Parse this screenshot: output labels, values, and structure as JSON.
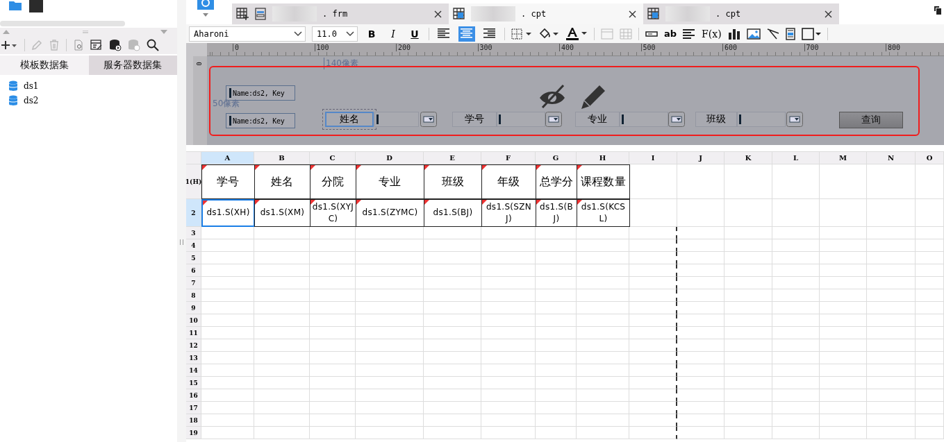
{
  "left_panel": {
    "tabs": [
      {
        "label": "模板数据集",
        "selected": true
      },
      {
        "label": "服务器数据集",
        "selected": false
      }
    ],
    "datasets": [
      {
        "name": "ds1"
      },
      {
        "name": "ds2"
      }
    ]
  },
  "file_tabs": [
    {
      "label": ". frm",
      "selected": false
    },
    {
      "label": ". cpt",
      "selected": true
    },
    {
      "label": ". cpt",
      "selected": false
    }
  ],
  "format_bar": {
    "font": "Aharoni",
    "size": "11.0",
    "style_buttons": [
      "B",
      "I",
      "U"
    ],
    "align": [
      {
        "selected": false
      },
      {
        "selected": true
      },
      {
        "selected": false
      }
    ],
    "text_tool": "ab",
    "formula_tool": "F(x)"
  },
  "ruler": {
    "ticks": [
      "0",
      "100",
      "200",
      "300",
      "400",
      "500",
      "600",
      "700",
      "800"
    ],
    "vertical_tick": "0"
  },
  "form": {
    "width_note": "140像素",
    "height_note": "50像素",
    "widgets": [
      {
        "kind": "name",
        "text": "Name:ds2, Key"
      },
      {
        "kind": "name",
        "text": "Name:ds2, Key"
      },
      {
        "kind": "label",
        "text": "姓名",
        "selected": true
      },
      {
        "kind": "combo"
      },
      {
        "kind": "label",
        "text": "学号",
        "selected": false
      },
      {
        "kind": "combo"
      },
      {
        "kind": "label",
        "text": "专业",
        "selected": false
      },
      {
        "kind": "combo"
      },
      {
        "kind": "label",
        "text": "班级",
        "selected": false
      },
      {
        "kind": "combo"
      },
      {
        "kind": "button",
        "text": "查询"
      }
    ]
  },
  "sheet": {
    "columns": [
      {
        "label": "A",
        "selected": true
      },
      {
        "label": "B",
        "selected": false
      },
      {
        "label": "C",
        "selected": false
      },
      {
        "label": "D",
        "selected": false
      },
      {
        "label": "E",
        "selected": false
      },
      {
        "label": "F",
        "selected": false
      },
      {
        "label": "G",
        "selected": false
      },
      {
        "label": "H",
        "selected": false
      },
      {
        "label": "I",
        "selected": false
      },
      {
        "label": "J",
        "selected": false
      },
      {
        "label": "K",
        "selected": false
      },
      {
        "label": "L",
        "selected": false
      },
      {
        "label": "M",
        "selected": false
      },
      {
        "label": "N",
        "selected": false
      },
      {
        "label": "O",
        "selected": false
      }
    ],
    "rows": [
      {
        "label": "1(H)",
        "selected": false,
        "cells": [
          {
            "text": "学号",
            "selected": false
          },
          {
            "text": "姓名",
            "selected": false
          },
          {
            "text": "分院",
            "selected": false
          },
          {
            "text": "专业",
            "selected": false
          },
          {
            "text": "班级",
            "selected": false
          },
          {
            "text": "年级",
            "selected": false
          },
          {
            "text": "总学分",
            "selected": false
          },
          {
            "text": "课程数量",
            "selected": false
          }
        ]
      },
      {
        "label": "2",
        "selected": true,
        "cells": [
          {
            "text": "ds1.S(XH)",
            "selected": true
          },
          {
            "text": "ds1.S(XM)",
            "selected": false
          },
          {
            "text": "ds1.S(XYJC)",
            "selected": false
          },
          {
            "text": "ds1.S(ZYMC)",
            "selected": false
          },
          {
            "text": "ds1.S(BJ)",
            "selected": false
          },
          {
            "text": "ds1.S(SZNJ)",
            "selected": false
          },
          {
            "text": "ds1.S(BJ)",
            "selected": false
          },
          {
            "text": "ds1.S(KCSL)",
            "selected": false
          }
        ]
      },
      {
        "label": "3",
        "selected": false,
        "cells": []
      },
      {
        "label": "4",
        "selected": false,
        "cells": []
      },
      {
        "label": "5",
        "selected": false,
        "cells": []
      },
      {
        "label": "6",
        "selected": false,
        "cells": []
      },
      {
        "label": "7",
        "selected": false,
        "cells": []
      },
      {
        "label": "8",
        "selected": false,
        "cells": []
      },
      {
        "label": "9",
        "selected": false,
        "cells": []
      },
      {
        "label": "10",
        "selected": false,
        "cells": []
      },
      {
        "label": "11",
        "selected": false,
        "cells": []
      },
      {
        "label": "12",
        "selected": false,
        "cells": []
      },
      {
        "label": "13",
        "selected": false,
        "cells": []
      },
      {
        "label": "14",
        "selected": false,
        "cells": []
      },
      {
        "label": "15",
        "selected": false,
        "cells": []
      },
      {
        "label": "16",
        "selected": false,
        "cells": []
      },
      {
        "label": "17",
        "selected": false,
        "cells": []
      },
      {
        "label": "18",
        "selected": false,
        "cells": []
      },
      {
        "label": "19",
        "selected": false,
        "cells": []
      }
    ]
  }
}
